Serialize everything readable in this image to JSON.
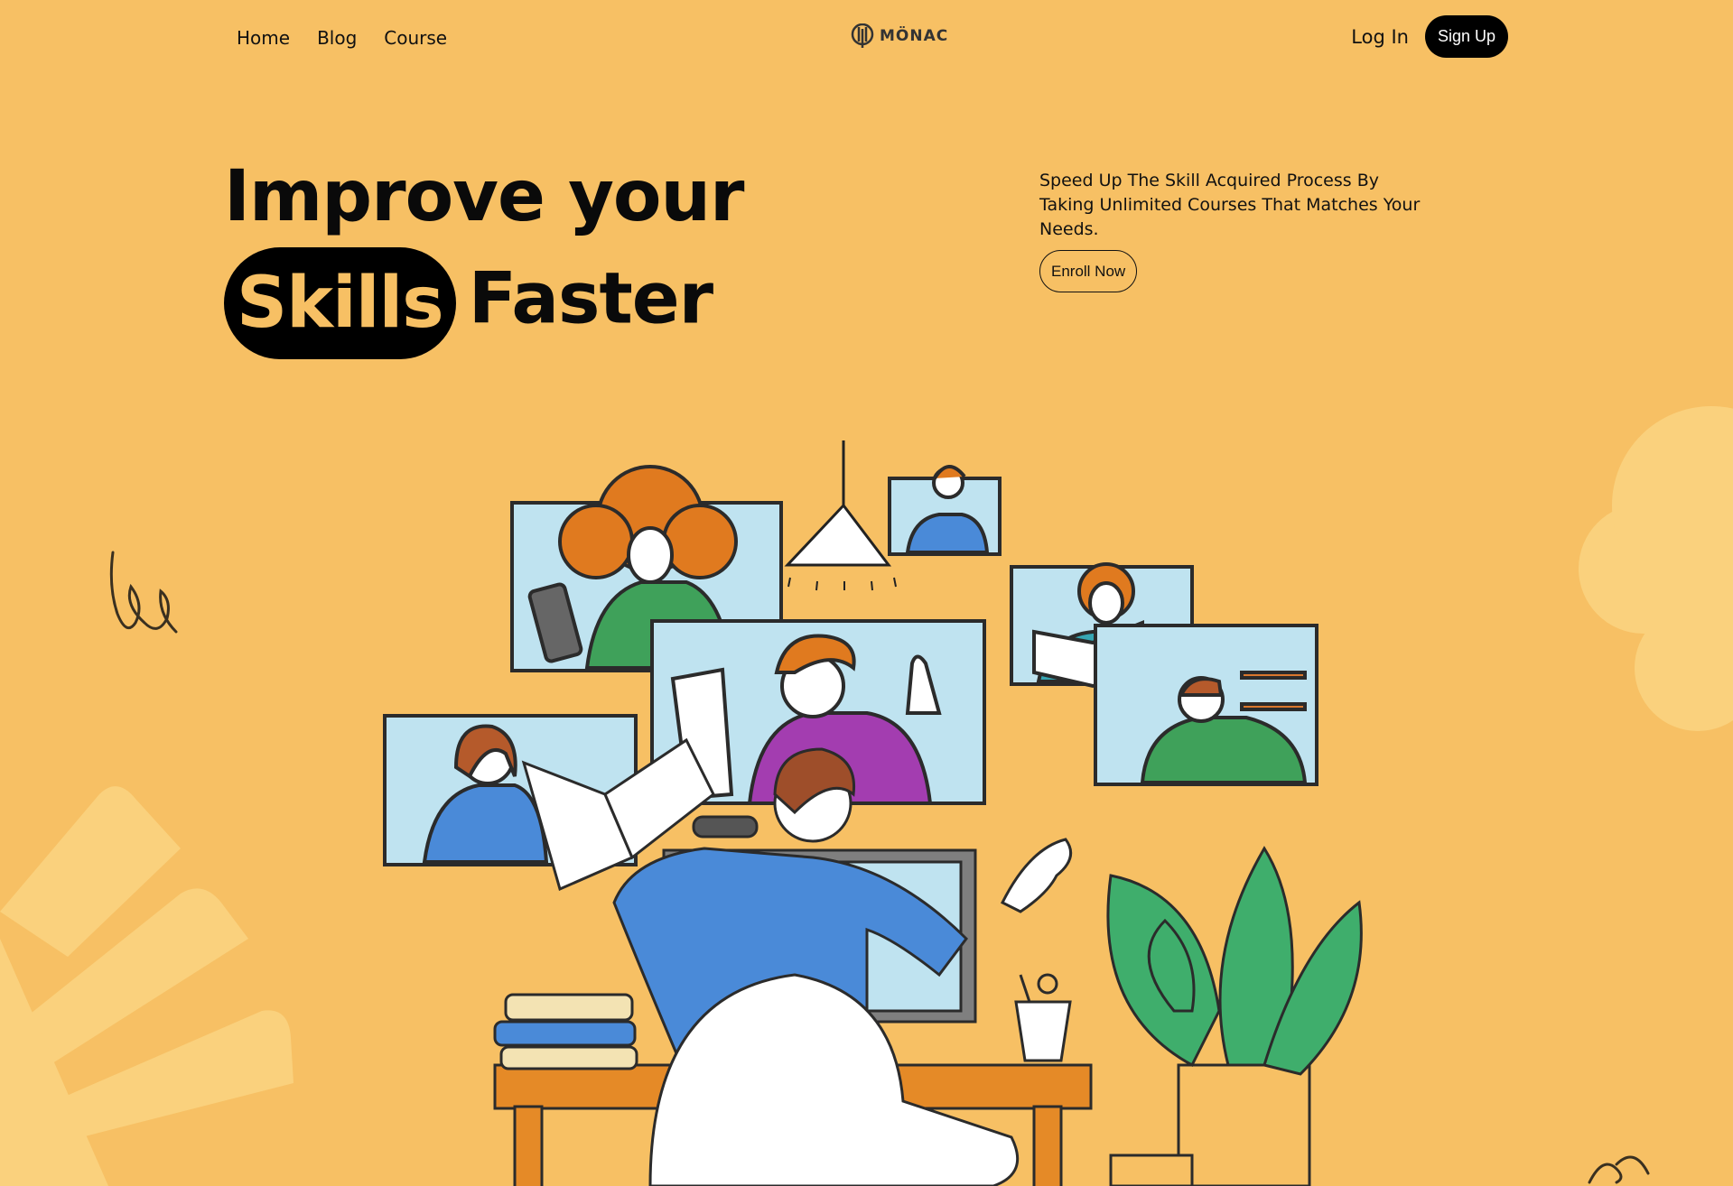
{
  "nav": {
    "links": [
      {
        "label": "Home"
      },
      {
        "label": "Blog"
      },
      {
        "label": "Course"
      }
    ],
    "brand": "MÖNAC",
    "login_label": "Log In",
    "signup_label": "Sign Up"
  },
  "hero": {
    "title_line1": "Improve your",
    "title_highlight": "Skills",
    "title_line2_rest": "Faster",
    "description": "Speed Up The Skill Acquired Process By Taking Unlimited Courses That Matches Your Needs.",
    "cta_label": "Enroll Now"
  },
  "colors": {
    "background": "#F7C064",
    "accent_dark": "#000000",
    "decor_light": "#FAD27E"
  }
}
